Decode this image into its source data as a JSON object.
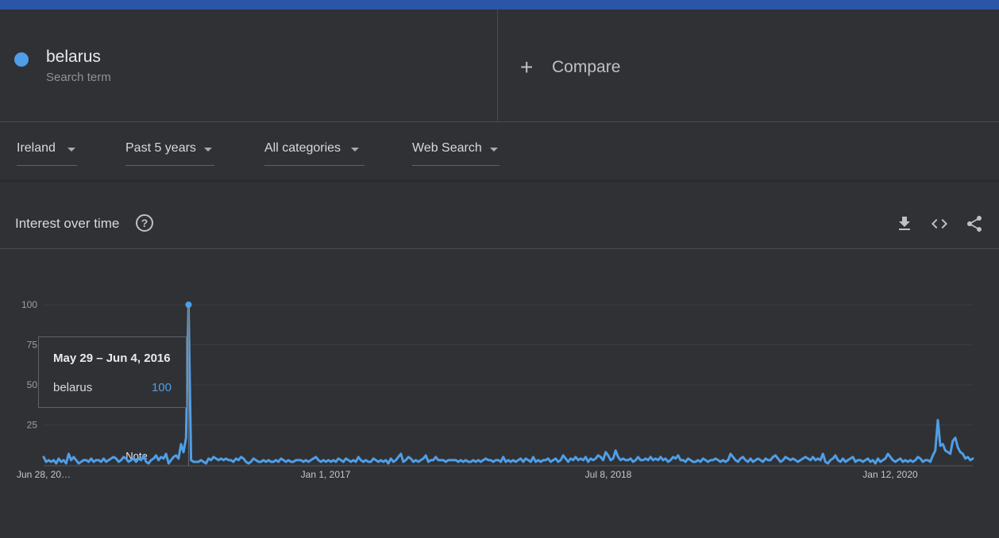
{
  "colors": {
    "series": "#4f9ee8",
    "top_bar": "#2b56a8",
    "background": "#303134"
  },
  "search_term": {
    "name": "belarus",
    "subtitle": "Search term"
  },
  "compare": {
    "icon": "plus-icon",
    "label": "Compare"
  },
  "filters": [
    {
      "label": "Ireland"
    },
    {
      "label": "Past 5 years"
    },
    {
      "label": "All categories"
    },
    {
      "label": "Web Search"
    }
  ],
  "card": {
    "title": "Interest over time",
    "help_icon": "?",
    "actions": [
      "download-icon",
      "embed-icon",
      "share-icon"
    ]
  },
  "tooltip": {
    "date": "May 29 – Jun 4, 2016",
    "term": "belarus",
    "value": "100"
  },
  "chart_data": {
    "type": "line",
    "y_ticks": [
      "100",
      "75",
      "50",
      "25"
    ],
    "ylim": [
      0,
      100
    ],
    "x_ticks": [
      "Jun 28, 20…",
      "Jan 1, 2017",
      "Jul 8, 2018",
      "Jan 12, 2020"
    ],
    "note_label": "Note",
    "grid": true,
    "series": [
      {
        "name": "belarus",
        "values": [
          5,
          2,
          3,
          2,
          3,
          1,
          4,
          2,
          3,
          1,
          7,
          3,
          5,
          3,
          1,
          2,
          3,
          3,
          2,
          4,
          2,
          3,
          3,
          2,
          4,
          2,
          3,
          4,
          5,
          4,
          2,
          3,
          5,
          4,
          2,
          3,
          4,
          2,
          4,
          3,
          6,
          2,
          1,
          3,
          4,
          6,
          3,
          5,
          4,
          7,
          1,
          3,
          5,
          6,
          4,
          13,
          8,
          17,
          100,
          3,
          2,
          2,
          2,
          3,
          2,
          1,
          4,
          3,
          5,
          4,
          3,
          4,
          3,
          4,
          3,
          3,
          2,
          4,
          3,
          5,
          4,
          2,
          1,
          2,
          4,
          3,
          2,
          2,
          3,
          2,
          3,
          2,
          2,
          3,
          2,
          4,
          3,
          2,
          3,
          2,
          2,
          3,
          3,
          3,
          2,
          3,
          2,
          3,
          4,
          5,
          3,
          2,
          3,
          2,
          3,
          2,
          3,
          2,
          4,
          3,
          2,
          4,
          3,
          2,
          3,
          2,
          5,
          3,
          2,
          3,
          2,
          2,
          4,
          3,
          2,
          3,
          2,
          3,
          1,
          4,
          2,
          3,
          5,
          7,
          2,
          3,
          5,
          4,
          2,
          3,
          2,
          3,
          4,
          6,
          2,
          3,
          3,
          5,
          3,
          3,
          3,
          2,
          3,
          3,
          3,
          3,
          2,
          3,
          2,
          3,
          2,
          2,
          3,
          2,
          3,
          2,
          3,
          4,
          3,
          3,
          2,
          3,
          3,
          2,
          5,
          2,
          3,
          2,
          3,
          2,
          3,
          4,
          2,
          4,
          3,
          2,
          5,
          2,
          3,
          2,
          3,
          3,
          4,
          2,
          3,
          4,
          2,
          3,
          6,
          4,
          2,
          4,
          3,
          5,
          3,
          4,
          3,
          5,
          2,
          4,
          3,
          4,
          6,
          5,
          3,
          8,
          6,
          3,
          4,
          9,
          5,
          3,
          4,
          3,
          3,
          4,
          2,
          3,
          5,
          3,
          3,
          4,
          3,
          5,
          3,
          4,
          3,
          5,
          3,
          4,
          2,
          3,
          5,
          4,
          6,
          3,
          3,
          2,
          4,
          3,
          2,
          2,
          3,
          2,
          4,
          3,
          2,
          3,
          3,
          4,
          3,
          2,
          3,
          2,
          3,
          7,
          5,
          3,
          2,
          4,
          5,
          3,
          2,
          4,
          2,
          3,
          4,
          3,
          2,
          4,
          3,
          3,
          5,
          6,
          4,
          2,
          3,
          5,
          4,
          3,
          4,
          3,
          2,
          3,
          4,
          5,
          4,
          3,
          5,
          3,
          4,
          3,
          7,
          2,
          1,
          3,
          4,
          6,
          3,
          2,
          4,
          2,
          3,
          4,
          5,
          2,
          3,
          3,
          2,
          3,
          4,
          2,
          3,
          1,
          4,
          2,
          3,
          4,
          7,
          5,
          3,
          2,
          3,
          4,
          2,
          3,
          2,
          3,
          2,
          3,
          5,
          4,
          2,
          3,
          3,
          2,
          6,
          9,
          28,
          12,
          13,
          9,
          8,
          7,
          15,
          17,
          11,
          8,
          7,
          4,
          5,
          3,
          4
        ]
      }
    ]
  }
}
